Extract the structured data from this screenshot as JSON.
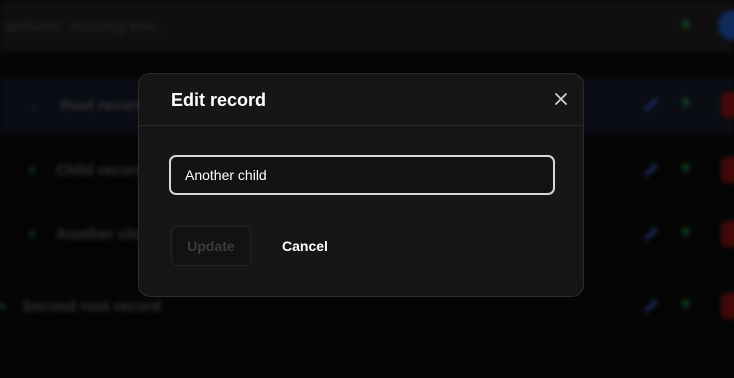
{
  "background": {
    "search_placeholder": "r attributes, including their...",
    "rows": [
      {
        "label": "Root record",
        "expander": "⌄",
        "selected": true
      },
      {
        "label": "Child record",
        "expander": "+",
        "selected": false
      },
      {
        "label": "Another child",
        "expander": "+",
        "selected": false
      },
      {
        "label": "Second root record",
        "expander": "+",
        "selected": false
      }
    ],
    "colors": {
      "edit": "#2c4f9c",
      "add": "#1f8a3a",
      "delete": "#7a1212"
    }
  },
  "modal": {
    "title": "Edit record",
    "close_icon": "close-icon",
    "input_value": "Another child",
    "update_label": "Update",
    "update_disabled": true,
    "cancel_label": "Cancel"
  }
}
